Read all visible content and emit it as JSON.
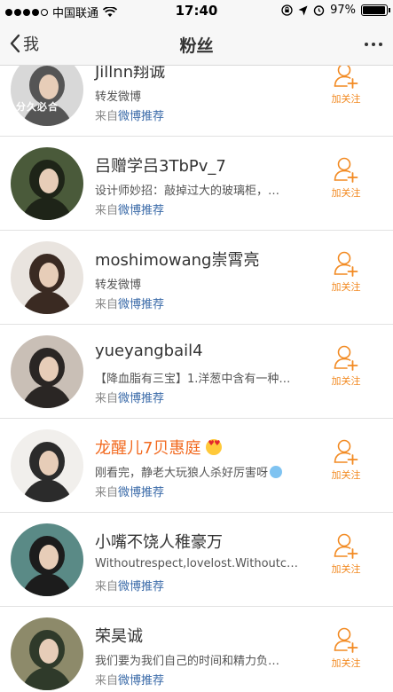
{
  "status_bar": {
    "carrier": "中国联通",
    "time": "17:40",
    "battery": "97%",
    "battery_level": 0.97,
    "icons": [
      "signal-dots",
      "wifi-icon",
      "lock-rotation-icon",
      "location-icon",
      "alarm-icon",
      "battery-icon"
    ]
  },
  "nav": {
    "back_label": "我",
    "title": "粉丝",
    "more_icon": "more-dots-icon"
  },
  "colors": {
    "accent": "#f28a22",
    "link": "#3a6aa8",
    "vip_name": "#f26a20"
  },
  "users": [
    {
      "name": "Jillnn翔诚",
      "desc": "转发微博",
      "source_prefix": "来自",
      "source_link": "微博推荐",
      "follow": "加关注",
      "avatar_text": "分久必合",
      "avatar_colors": [
        "#d8d8d8",
        "#555555"
      ]
    },
    {
      "name": "吕赠学吕3TbPv_7",
      "desc": "设计师妙招：敲掉过大的玻璃柜，…",
      "source_prefix": "来自",
      "source_link": "微博推荐",
      "follow": "加关注",
      "avatar_colors": [
        "#4a5a3a",
        "#1e2418"
      ]
    },
    {
      "name": "moshimowang崇霄亮",
      "desc": "转发微博",
      "source_prefix": "来自",
      "source_link": "微博推荐",
      "follow": "加关注",
      "avatar_colors": [
        "#e9e4df",
        "#3a2a22"
      ]
    },
    {
      "name": "yueyangbail4",
      "desc": "【降血脂有三宝】1.洋葱中含有一种…",
      "source_prefix": "来自",
      "source_link": "微博推荐",
      "follow": "加关注",
      "avatar_colors": [
        "#c9bfb6",
        "#2a2624"
      ]
    },
    {
      "name": "龙醒儿7贝惠庭",
      "vip": true,
      "desc": "刚看完，静老大玩狼人杀好厉害呀",
      "source_prefix": "来自",
      "source_link": "微博推荐",
      "follow": "加关注",
      "avatar_colors": [
        "#f1efec",
        "#2b2b2b"
      ]
    },
    {
      "name": "小嘴不饶人稚豪万",
      "desc": "Withoutrespect,lovelost.Withoutc…",
      "source_prefix": "来自",
      "source_link": "微博推荐",
      "follow": "加关注",
      "avatar_colors": [
        "#5a8a86",
        "#1c1c1c"
      ]
    },
    {
      "name": "荣昊诚",
      "desc": "我们要为我们自己的时间和精力负…",
      "source_prefix": "来自",
      "source_link": "微博推荐",
      "follow": "加关注",
      "avatar_colors": [
        "#8d8a6a",
        "#2f3a2a"
      ]
    }
  ]
}
